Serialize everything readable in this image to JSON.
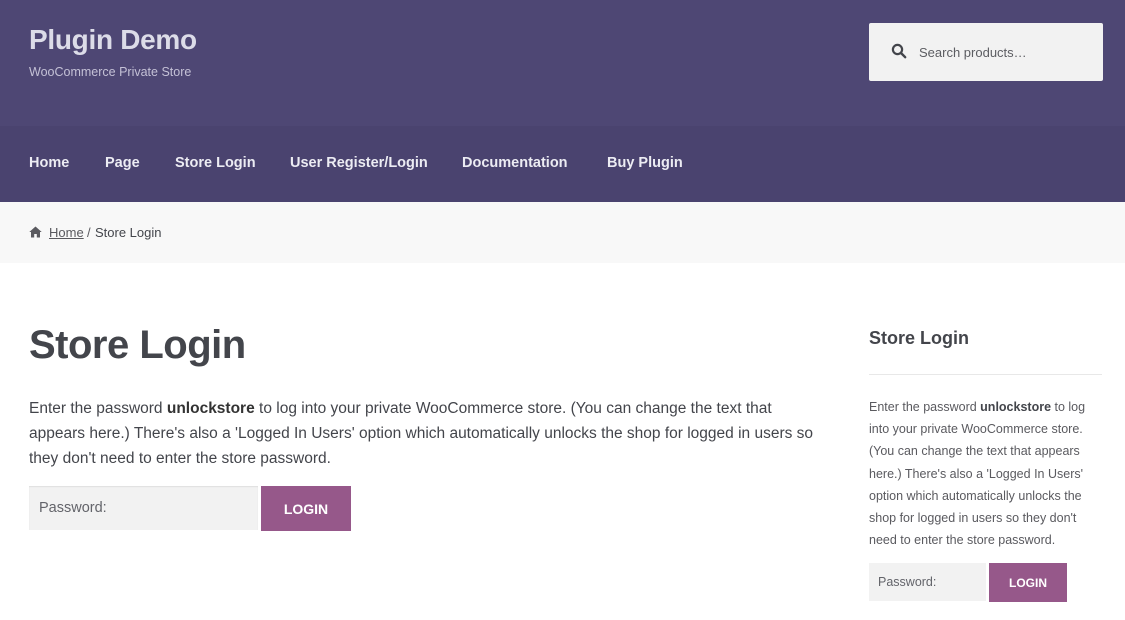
{
  "site": {
    "title": "Plugin Demo",
    "tagline": "WooCommerce Private Store"
  },
  "search": {
    "placeholder": "Search products…",
    "icon": "search-icon"
  },
  "nav": {
    "items": [
      {
        "label": "Home"
      },
      {
        "label": "Page"
      },
      {
        "label": "Store Login"
      },
      {
        "label": "User Register/Login"
      },
      {
        "label": "Documentation"
      },
      {
        "label": "Buy Plugin"
      }
    ]
  },
  "breadcrumb": {
    "icon": "home-icon",
    "home": "Home",
    "separator": "/",
    "current": "Store Login"
  },
  "main": {
    "title": "Store Login",
    "intro_before": "Enter the password ",
    "intro_password": "unlockstore",
    "intro_after": " to log into your private WooCommerce store. (You can change the text that appears here.) There's also a 'Logged In Users' option which automatically unlocks the shop for logged in users so they don't need to enter the store password.",
    "password_placeholder": "Password:",
    "login_label": "LOGIN"
  },
  "sidebar": {
    "title": "Store Login",
    "text_before": "Enter the password ",
    "text_password": "unlockstore",
    "text_after": " to log into your private WooCommerce store. (You can change the text that appears here.) There's also a 'Logged In Users' option which automatically unlocks the shop for logged in users so they don't need to enter the store password.",
    "password_placeholder": "Password:",
    "login_label": "LOGIN"
  },
  "colors": {
    "header_bg": "#4e4774",
    "nav_bg": "#4a436f",
    "accent_button": "#96588a",
    "breadcrumb_bg": "#f8f8f8",
    "text": "#43454b"
  }
}
